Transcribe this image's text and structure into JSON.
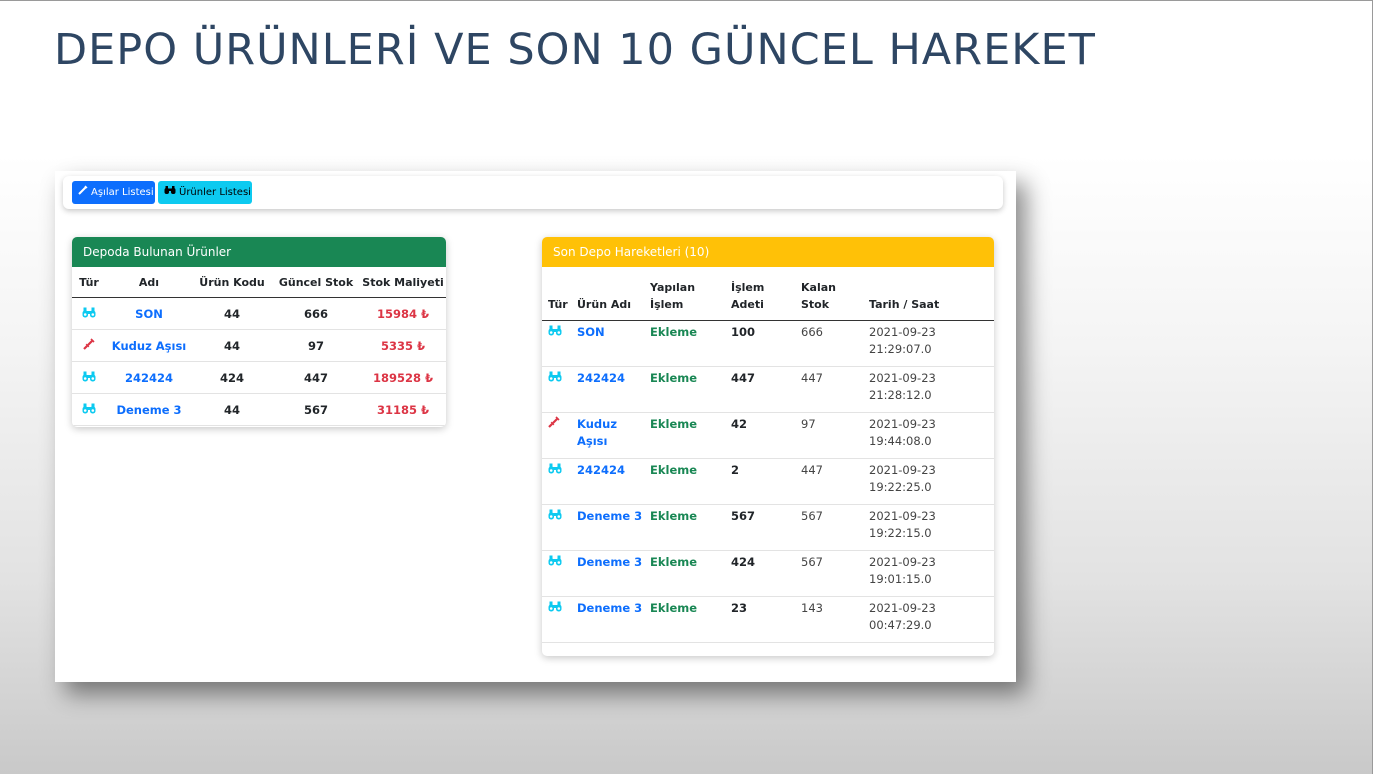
{
  "slide": {
    "title": "DEPO ÜRÜNLERİ VE SON 10 GÜNCEL HAREKET"
  },
  "navbar": {
    "buttons": [
      {
        "label": "Aşılar Listesi",
        "icon": "syringe-icon",
        "color": "#0d6efd"
      },
      {
        "label": "Ürünler Listesi",
        "icon": "binoculars-icon",
        "color": "#0dcaf0"
      }
    ]
  },
  "depot_products": {
    "header": "Depoda Bulunan Ürünler",
    "columns": [
      "Tür",
      "Adı",
      "Ürün Kodu",
      "Güncel Stok",
      "Stok Maliyeti"
    ],
    "rows": [
      {
        "type_icon": "binoculars-icon",
        "name": "SON",
        "code": "44",
        "stock": "666",
        "cost": "15984 ₺"
      },
      {
        "type_icon": "syringe-icon",
        "name": "Kuduz Aşısı",
        "code": "44",
        "stock": "97",
        "cost": "5335 ₺"
      },
      {
        "type_icon": "binoculars-icon",
        "name": "242424",
        "code": "424",
        "stock": "447",
        "cost": "189528 ₺"
      },
      {
        "type_icon": "binoculars-icon",
        "name": "Deneme 3",
        "code": "44",
        "stock": "567",
        "cost": "31185 ₺"
      }
    ]
  },
  "recent_movements": {
    "header": "Son Depo Hareketleri (10)",
    "columns": [
      "Tür",
      "Ürün Adı",
      "Yapılan İşlem",
      "İşlem Adeti",
      "Kalan Stok",
      "Tarih / Saat"
    ],
    "rows": [
      {
        "type_icon": "binoculars-icon",
        "name": "SON",
        "action": "Ekleme",
        "qty": "100",
        "remaining": "666",
        "date": "2021-09-23",
        "time": "21:29:07.0"
      },
      {
        "type_icon": "binoculars-icon",
        "name": "242424",
        "action": "Ekleme",
        "qty": "447",
        "remaining": "447",
        "date": "2021-09-23",
        "time": "21:28:12.0"
      },
      {
        "type_icon": "syringe-icon",
        "name": "Kuduz Aşısı",
        "action": "Ekleme",
        "qty": "42",
        "remaining": "97",
        "date": "2021-09-23",
        "time": "19:44:08.0"
      },
      {
        "type_icon": "binoculars-icon",
        "name": "242424",
        "action": "Ekleme",
        "qty": "2",
        "remaining": "447",
        "date": "2021-09-23",
        "time": "19:22:25.0"
      },
      {
        "type_icon": "binoculars-icon",
        "name": "Deneme 3",
        "action": "Ekleme",
        "qty": "567",
        "remaining": "567",
        "date": "2021-09-23",
        "time": "19:22:15.0"
      },
      {
        "type_icon": "binoculars-icon",
        "name": "Deneme 3",
        "action": "Ekleme",
        "qty": "424",
        "remaining": "567",
        "date": "2021-09-23",
        "time": "19:01:15.0"
      },
      {
        "type_icon": "binoculars-icon",
        "name": "Deneme 3",
        "action": "Ekleme",
        "qty": "23",
        "remaining": "143",
        "date": "2021-09-23",
        "time": "00:47:29.0"
      }
    ]
  },
  "colors": {
    "primary": "#0d6efd",
    "info": "#0dcaf0",
    "success": "#198754",
    "warning": "#ffc107",
    "danger": "#dc3545",
    "title": "#2e4663"
  }
}
